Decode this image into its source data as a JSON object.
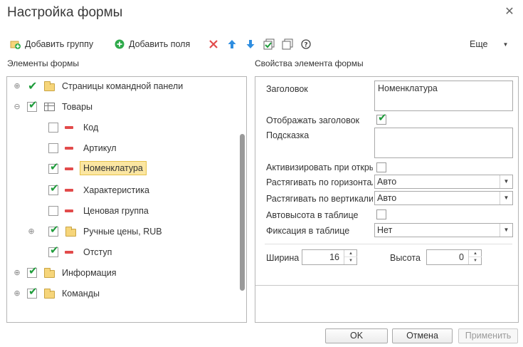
{
  "window": {
    "title": "Настройка формы",
    "close_glyph": "✕"
  },
  "toolbar": {
    "add_group": "Добавить группу",
    "add_fields": "Добавить поля",
    "more": "Еще"
  },
  "left_panel": {
    "title": "Элементы формы"
  },
  "right_panel": {
    "title": "Свойства элемента формы"
  },
  "tree": [
    {
      "label": "Страницы командной панели",
      "checked": true,
      "icon": "folder-icon",
      "expander": "plus"
    },
    {
      "label": "Товары",
      "checked": true,
      "icon": "table-icon",
      "expander": "minus"
    },
    {
      "label": "Код",
      "checked": false,
      "icon": "field-icon"
    },
    {
      "label": "Артикул",
      "checked": false,
      "icon": "field-icon"
    },
    {
      "label": "Номенклатура",
      "checked": true,
      "icon": "field-icon",
      "selected": true
    },
    {
      "label": "Характеристика",
      "checked": true,
      "icon": "field-icon"
    },
    {
      "label": "Ценовая группа",
      "checked": false,
      "icon": "field-icon"
    },
    {
      "label": "Ручные цены, RUB",
      "checked": true,
      "icon": "folder-icon",
      "expander": "plus"
    },
    {
      "label": "Отступ",
      "checked": true,
      "icon": "field-icon"
    },
    {
      "label": "Информация",
      "checked": true,
      "icon": "folder-icon",
      "expander": "plus"
    },
    {
      "label": "Команды",
      "checked": true,
      "icon": "folder-icon",
      "expander": "plus"
    }
  ],
  "properties": {
    "header_label": "Заголовок",
    "header_value": "Номенклатура",
    "show_header_label": "Отображать заголовок",
    "show_header_checked": true,
    "hint_label": "Подсказка",
    "hint_value": "",
    "activate_label": "Активизировать при откры",
    "activate_checked": false,
    "stretch_h_label": "Растягивать по горизонтал",
    "stretch_h_value": "Авто",
    "stretch_v_label": "Растягивать по вертикали",
    "stretch_v_value": "Авто",
    "autoheight_label": "Автовысота в таблице",
    "autoheight_checked": false,
    "fix_label": "Фиксация в таблице",
    "fix_value": "Нет",
    "width_label": "Ширина",
    "width_value": "16",
    "height_label": "Высота",
    "height_value": "0"
  },
  "buttons": {
    "ok": "OK",
    "cancel": "Отмена",
    "apply": "Применить"
  },
  "colors": {
    "check": "#1f9c3b",
    "delete": "#e24b4b",
    "arrow": "#2f8ee0",
    "selection": "#fbe6a2"
  }
}
